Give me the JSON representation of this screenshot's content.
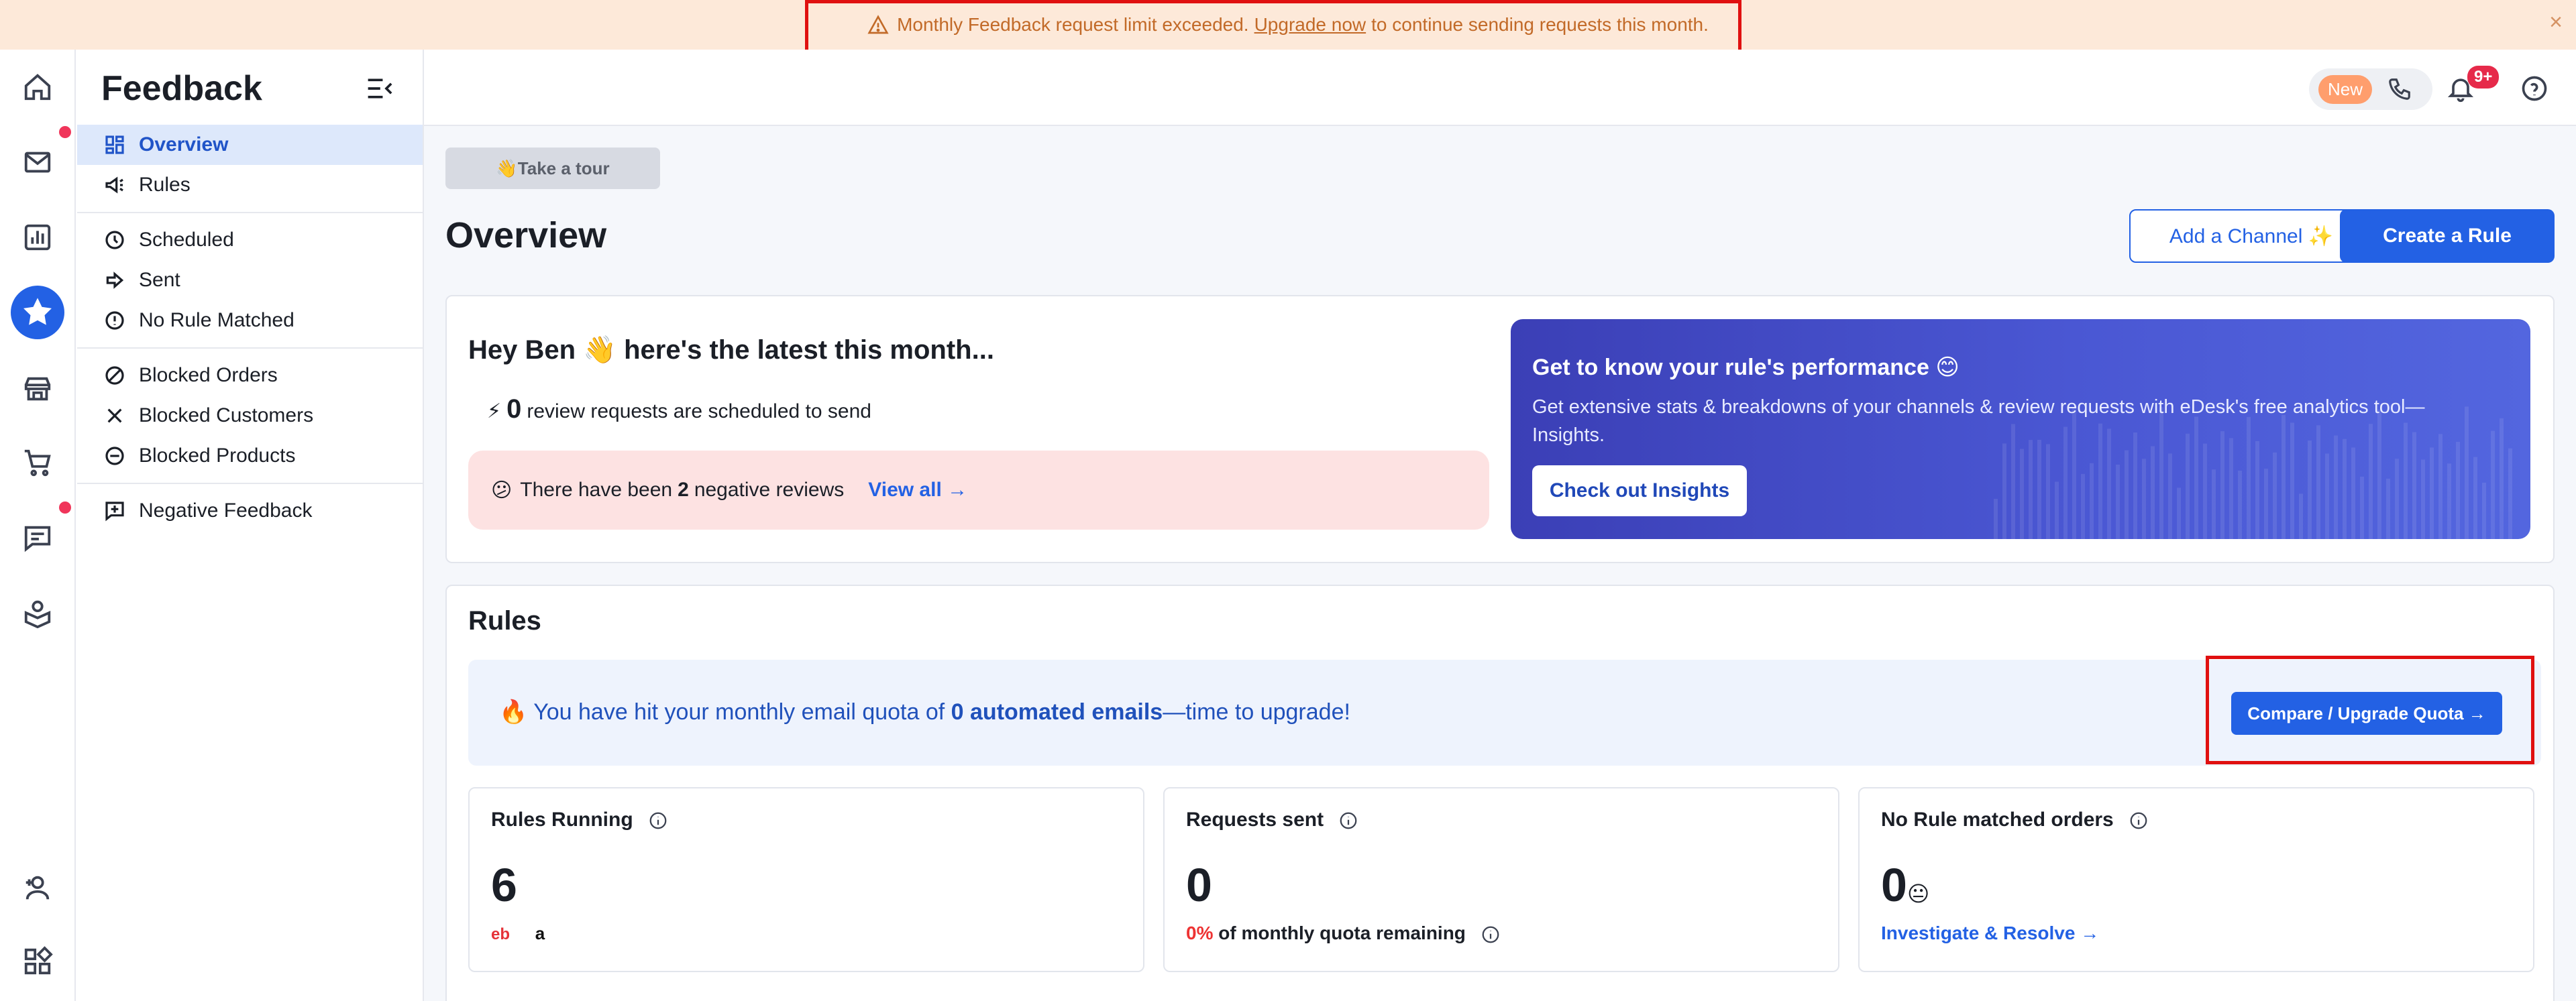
{
  "banner": {
    "message_pre": "Monthly Feedback request limit exceeded.",
    "link": "Upgrade now",
    "message_post": "to continue sending requests this month.",
    "close": "×"
  },
  "sidebar": {
    "title": "Feedback",
    "items": [
      {
        "label": "Overview",
        "icon": "overview-icon",
        "active": true
      },
      {
        "label": "Rules",
        "icon": "megaphone-icon"
      },
      {
        "label": "Scheduled",
        "icon": "clock-icon"
      },
      {
        "label": "Sent",
        "icon": "arrow-right-icon"
      },
      {
        "label": "No Rule Matched",
        "icon": "alert-circle-icon"
      },
      {
        "label": "Blocked Orders",
        "icon": "block-icon"
      },
      {
        "label": "Blocked Customers",
        "icon": "x-icon"
      },
      {
        "label": "Blocked Products",
        "icon": "minus-circle-icon"
      },
      {
        "label": "Negative Feedback",
        "icon": "feedback-plus-icon"
      }
    ]
  },
  "header": {
    "new_badge": "New",
    "notification_count": "9+"
  },
  "main": {
    "tour": "👋Take a tour",
    "title": "Overview",
    "add_channel": "Add a Channel ✨",
    "create_rule": "Create a Rule",
    "summary": {
      "greeting": "Hey Ben 👋 here's the latest this month...",
      "scheduled_icon": "⚡",
      "scheduled_count": "0",
      "scheduled_text": "review requests are scheduled to send",
      "negative_icon": "😕",
      "negative_pre": "There have been",
      "negative_count": "2",
      "negative_post": "negative reviews",
      "view_all": "View all →"
    },
    "insights": {
      "title": "Get to know your rule's performance 😊",
      "desc": "Get extensive stats & breakdowns of your channels & review requests with eDesk's free analytics tool—Insights.",
      "button": "Check out Insights"
    },
    "rules": {
      "title": "Rules",
      "quota_icon": "🔥",
      "quota_pre": "You have hit your monthly email quota of",
      "quota_bold": "0 automated emails",
      "quota_post": "—time to upgrade!",
      "upgrade": "Compare / Upgrade Quota →"
    },
    "stats": [
      {
        "title": "Rules Running",
        "value": "6",
        "sub1": "eb",
        "sub2": "a"
      },
      {
        "title": "Requests sent",
        "value": "0",
        "pct": "0%",
        "sub": "of monthly quota remaining"
      },
      {
        "title": "No Rule matched orders",
        "value": "0",
        "emoji": "😐",
        "link": "Investigate & Resolve →"
      }
    ]
  },
  "colors": {
    "accent": "#2361e4",
    "banner_bg": "#fde9d9",
    "banner_text": "#c26a28",
    "highlight_box": "#e01010"
  }
}
